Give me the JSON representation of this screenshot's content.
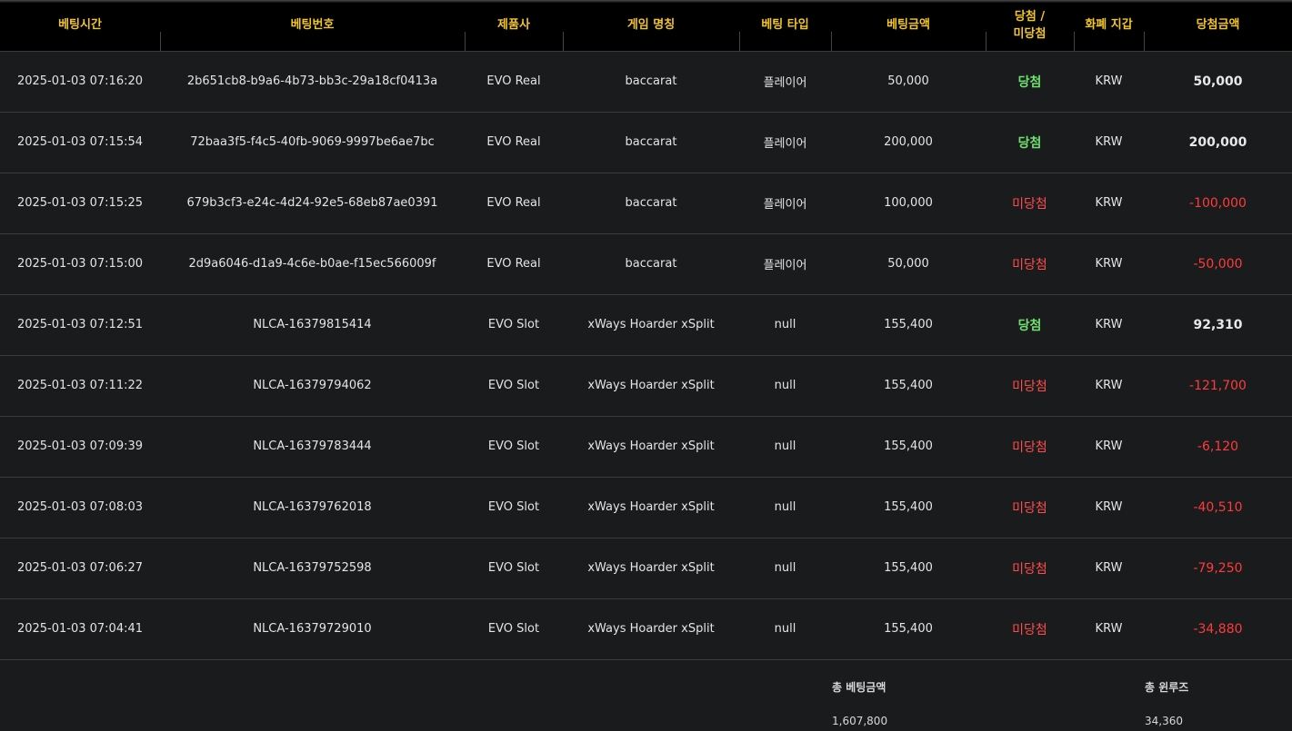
{
  "headers": {
    "time": "베팅시간",
    "id": "베팅번호",
    "provider": "제품사",
    "game": "게임 명칭",
    "bet_type": "베팅 타입",
    "bet_amount": "베팅금액",
    "result_line1": "당첨 /",
    "result_line2": "미당첨",
    "currency": "화폐 지갑",
    "win_amount": "당첨금액"
  },
  "rows": [
    {
      "time": "2025-01-03 07:16:20",
      "id": "2b651cb8-b9a6-4b73-bb3c-29a18cf0413a",
      "provider": "EVO Real",
      "game": "baccarat",
      "bet_type": "플레이어",
      "bet_amount": "50,000",
      "result": "당첨",
      "win": true,
      "currency": "KRW",
      "win_amount": "50,000"
    },
    {
      "time": "2025-01-03 07:15:54",
      "id": "72baa3f5-f4c5-40fb-9069-9997be6ae7bc",
      "provider": "EVO Real",
      "game": "baccarat",
      "bet_type": "플레이어",
      "bet_amount": "200,000",
      "result": "당첨",
      "win": true,
      "currency": "KRW",
      "win_amount": "200,000"
    },
    {
      "time": "2025-01-03 07:15:25",
      "id": "679b3cf3-e24c-4d24-92e5-68eb87ae0391",
      "provider": "EVO Real",
      "game": "baccarat",
      "bet_type": "플레이어",
      "bet_amount": "100,000",
      "result": "미당첨",
      "win": false,
      "currency": "KRW",
      "win_amount": "-100,000"
    },
    {
      "time": "2025-01-03 07:15:00",
      "id": "2d9a6046-d1a9-4c6e-b0ae-f15ec566009f",
      "provider": "EVO Real",
      "game": "baccarat",
      "bet_type": "플레이어",
      "bet_amount": "50,000",
      "result": "미당첨",
      "win": false,
      "currency": "KRW",
      "win_amount": "-50,000"
    },
    {
      "time": "2025-01-03 07:12:51",
      "id": "NLCA-16379815414",
      "provider": "EVO Slot",
      "game": "xWays Hoarder xSplit",
      "bet_type": "null",
      "bet_amount": "155,400",
      "result": "당첨",
      "win": true,
      "currency": "KRW",
      "win_amount": "92,310"
    },
    {
      "time": "2025-01-03 07:11:22",
      "id": "NLCA-16379794062",
      "provider": "EVO Slot",
      "game": "xWays Hoarder xSplit",
      "bet_type": "null",
      "bet_amount": "155,400",
      "result": "미당첨",
      "win": false,
      "currency": "KRW",
      "win_amount": "-121,700"
    },
    {
      "time": "2025-01-03 07:09:39",
      "id": "NLCA-16379783444",
      "provider": "EVO Slot",
      "game": "xWays Hoarder xSplit",
      "bet_type": "null",
      "bet_amount": "155,400",
      "result": "미당첨",
      "win": false,
      "currency": "KRW",
      "win_amount": "-6,120"
    },
    {
      "time": "2025-01-03 07:08:03",
      "id": "NLCA-16379762018",
      "provider": "EVO Slot",
      "game": "xWays Hoarder xSplit",
      "bet_type": "null",
      "bet_amount": "155,400",
      "result": "미당첨",
      "win": false,
      "currency": "KRW",
      "win_amount": "-40,510"
    },
    {
      "time": "2025-01-03 07:06:27",
      "id": "NLCA-16379752598",
      "provider": "EVO Slot",
      "game": "xWays Hoarder xSplit",
      "bet_type": "null",
      "bet_amount": "155,400",
      "result": "미당첨",
      "win": false,
      "currency": "KRW",
      "win_amount": "-79,250"
    },
    {
      "time": "2025-01-03 07:04:41",
      "id": "NLCA-16379729010",
      "provider": "EVO Slot",
      "game": "xWays Hoarder xSplit",
      "bet_type": "null",
      "bet_amount": "155,400",
      "result": "미당첨",
      "win": false,
      "currency": "KRW",
      "win_amount": "-34,880"
    }
  ],
  "summary": {
    "total_bet_label": "총 베팅금액",
    "total_bet_value": "1,607,800",
    "total_winloss_label": "총 윈루즈",
    "total_winloss_value": "34,360"
  },
  "colors": {
    "header_text": "#f3c623",
    "win": "#6ee06e",
    "lose": "#ff4d4d",
    "background": "#1a1b1d"
  }
}
